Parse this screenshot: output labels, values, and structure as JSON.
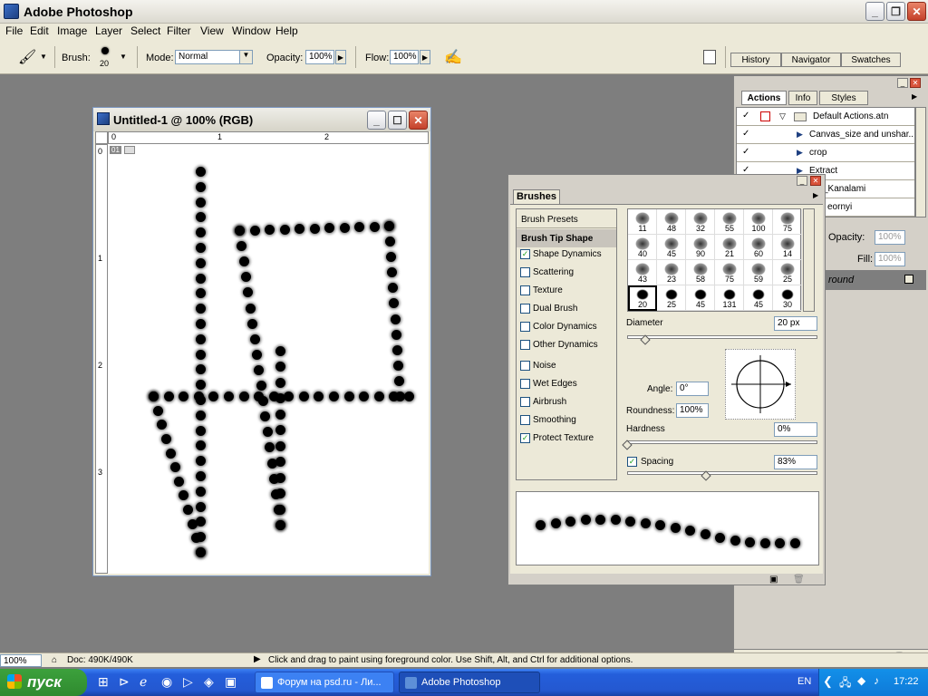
{
  "app": {
    "title": "Adobe Photoshop"
  },
  "menu": [
    "File",
    "Edit",
    "Image",
    "Layer",
    "Select",
    "Filter",
    "View",
    "Window",
    "Help"
  ],
  "options": {
    "brush_label": "Brush:",
    "brush_size": "20",
    "mode_label": "Mode:",
    "mode_value": "Normal",
    "opacity_label": "Opacity:",
    "opacity_value": "100%",
    "flow_label": "Flow:",
    "flow_value": "100%"
  },
  "dock_tabs": [
    "History",
    "Navigator",
    "Swatches"
  ],
  "document": {
    "title": "Untitled-1 @ 100% (RGB)",
    "ruler_h": [
      "0",
      "1",
      "2"
    ],
    "ruler_v": [
      "0",
      "1",
      "2",
      "3"
    ],
    "slice_label": "01"
  },
  "brushes": {
    "tab": "Brushes",
    "options": [
      {
        "label": "Brush Presets",
        "checkbox": false,
        "checked": false
      },
      {
        "label": "Brush Tip Shape",
        "checkbox": false,
        "checked": false,
        "selected": true
      },
      {
        "label": "Shape Dynamics",
        "checkbox": true,
        "checked": true
      },
      {
        "label": "Scattering",
        "checkbox": true,
        "checked": false
      },
      {
        "label": "Texture",
        "checkbox": true,
        "checked": false
      },
      {
        "label": "Dual Brush",
        "checkbox": true,
        "checked": false
      },
      {
        "label": "Color Dynamics",
        "checkbox": true,
        "checked": false
      },
      {
        "label": "Other Dynamics",
        "checkbox": true,
        "checked": false
      },
      {
        "label": "Noise",
        "checkbox": true,
        "checked": false
      },
      {
        "label": "Wet Edges",
        "checkbox": true,
        "checked": false
      },
      {
        "label": "Airbrush",
        "checkbox": true,
        "checked": false
      },
      {
        "label": "Smoothing",
        "checkbox": true,
        "checked": false
      },
      {
        "label": "Protect Texture",
        "checkbox": true,
        "checked": true
      }
    ],
    "tip_sizes": [
      "11",
      "48",
      "32",
      "55",
      "100",
      "75",
      "40",
      "45",
      "90",
      "21",
      "60",
      "14",
      "43",
      "23",
      "58",
      "75",
      "59",
      "25",
      "20",
      "25",
      "45",
      "131",
      "45",
      "30"
    ],
    "diameter_label": "Diameter",
    "diameter_value": "20 px",
    "angle_label": "Angle:",
    "angle_value": "0°",
    "roundness_label": "Roundness:",
    "roundness_value": "100%",
    "hardness_label": "Hardness",
    "hardness_value": "0%",
    "spacing_label": "Spacing",
    "spacing_value": "83%"
  },
  "right_panel": {
    "tabs": [
      "Actions",
      "Info",
      "Styles"
    ],
    "actions": [
      "Default Actions.atn",
      "Canvas_size and unshar...",
      "crop",
      "Extract",
      "z_Kanalami",
      "eornyi"
    ],
    "opacity_label": "Opacity:",
    "opacity_value": "100%",
    "fill_label": "Fill:",
    "fill_value": "100%",
    "layer_name": "round"
  },
  "status": {
    "zoom": "100%",
    "doc": "Doc: 490K/490K",
    "hint": "Click and drag to paint using foreground color.  Use Shift, Alt, and Ctrl for additional options."
  },
  "taskbar": {
    "start": "пуск",
    "items": [
      "Форум на psd.ru - Ли...",
      "Adobe Photoshop"
    ],
    "lang": "EN",
    "clock": "17:22"
  }
}
